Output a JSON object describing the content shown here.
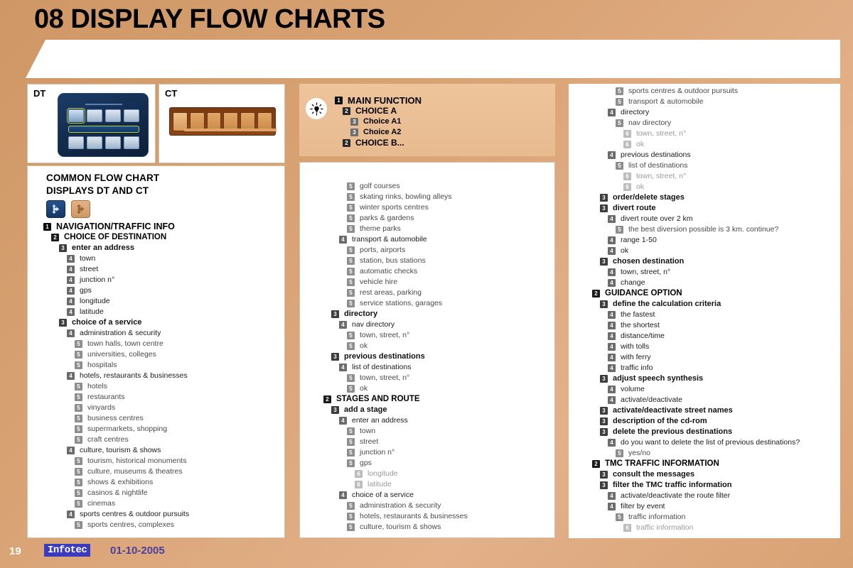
{
  "header": {
    "title": "08 DISPLAY FLOW CHARTS"
  },
  "panels": {
    "dt_label": "DT",
    "ct_label": "CT"
  },
  "left_panel": {
    "heading_line1": "COMMON FLOW CHART",
    "heading_line2": "DISPLAYS DT AND CT",
    "icons": [
      {
        "name": "navigation-arrow-icon-blue"
      },
      {
        "name": "navigation-arrow-icon-tan"
      }
    ],
    "tree": [
      {
        "level": 1,
        "label": "NAVIGATION/TRAFFIC INFO"
      },
      {
        "level": 2,
        "label": "CHOICE OF DESTINATION"
      },
      {
        "level": 3,
        "label": "enter an address"
      },
      {
        "level": 4,
        "label": "town"
      },
      {
        "level": 4,
        "label": "street"
      },
      {
        "level": 4,
        "label": "junction n°"
      },
      {
        "level": 4,
        "label": "gps"
      },
      {
        "level": 4,
        "label": "longitude"
      },
      {
        "level": 4,
        "label": "latitude"
      },
      {
        "level": 3,
        "label": "choice of a service"
      },
      {
        "level": 4,
        "label": "administration & security"
      },
      {
        "level": 5,
        "label": "town halls, town centre"
      },
      {
        "level": 5,
        "label": "universities, colleges"
      },
      {
        "level": 5,
        "label": "hospitals"
      },
      {
        "level": 4,
        "label": "hotels, restaurants & businesses"
      },
      {
        "level": 5,
        "label": "hotels"
      },
      {
        "level": 5,
        "label": "restaurants"
      },
      {
        "level": 5,
        "label": "vinyards"
      },
      {
        "level": 5,
        "label": "business centres"
      },
      {
        "level": 5,
        "label": "supermarkets, shopping"
      },
      {
        "level": 5,
        "label": "craft centres"
      },
      {
        "level": 4,
        "label": "culture, tourism & shows"
      },
      {
        "level": 5,
        "label": "tourism, historical monuments"
      },
      {
        "level": 5,
        "label": "culture, museums & theatres"
      },
      {
        "level": 5,
        "label": "shows & exhibitions"
      },
      {
        "level": 5,
        "label": "casinos & nightlife"
      },
      {
        "level": 5,
        "label": "cinemas"
      },
      {
        "level": 4,
        "label": "sports centres & outdoor pursuits"
      },
      {
        "level": 5,
        "label": "sports centres, complexes"
      }
    ]
  },
  "legend": {
    "icon": "lightbulb-icon",
    "tree": [
      {
        "level": 1,
        "label": "MAIN FUNCTION"
      },
      {
        "level": 2,
        "label": "CHOICE A"
      },
      {
        "level": 3,
        "label": "Choice A1"
      },
      {
        "level": 3,
        "label": "Choice A2"
      },
      {
        "level": 2,
        "label": "CHOICE  B..."
      }
    ]
  },
  "mid_panel": {
    "tree": [
      {
        "level": 5,
        "label": "golf courses"
      },
      {
        "level": 5,
        "label": "skating rinks, bowling alleys"
      },
      {
        "level": 5,
        "label": "winter sports centres"
      },
      {
        "level": 5,
        "label": "parks & gardens"
      },
      {
        "level": 5,
        "label": "theme parks"
      },
      {
        "level": 4,
        "label": "transport & automobile"
      },
      {
        "level": 5,
        "label": "ports, airports"
      },
      {
        "level": 5,
        "label": "station, bus stations"
      },
      {
        "level": 5,
        "label": "automatic checks"
      },
      {
        "level": 5,
        "label": "vehicle hire"
      },
      {
        "level": 5,
        "label": "rest areas, parking"
      },
      {
        "level": 5,
        "label": "service stations, garages"
      },
      {
        "level": 3,
        "label": "directory"
      },
      {
        "level": 4,
        "label": "nav directory"
      },
      {
        "level": 5,
        "label": "town, street, n°"
      },
      {
        "level": 5,
        "label": "ok"
      },
      {
        "level": 3,
        "label": "previous destinations"
      },
      {
        "level": 4,
        "label": "list of destinations"
      },
      {
        "level": 5,
        "label": "town, street, n°"
      },
      {
        "level": 5,
        "label": "ok"
      },
      {
        "level": 2,
        "label": "STAGES AND ROUTE"
      },
      {
        "level": 3,
        "label": "add a stage"
      },
      {
        "level": 4,
        "label": "enter an address"
      },
      {
        "level": 5,
        "label": "town"
      },
      {
        "level": 5,
        "label": "street"
      },
      {
        "level": 5,
        "label": "junction n°"
      },
      {
        "level": 5,
        "label": "gps"
      },
      {
        "level": 6,
        "label": "longitude"
      },
      {
        "level": 6,
        "label": "latitude"
      },
      {
        "level": 4,
        "label": "choice of a service"
      },
      {
        "level": 5,
        "label": "administration & security"
      },
      {
        "level": 5,
        "label": "hotels, restaurants & businesses"
      },
      {
        "level": 5,
        "label": "culture, tourism & shows"
      }
    ]
  },
  "right_panel": {
    "tree": [
      {
        "level": 5,
        "label": "sports centres & outdoor pursuits"
      },
      {
        "level": 5,
        "label": "transport & automobile"
      },
      {
        "level": 4,
        "label": "directory"
      },
      {
        "level": 5,
        "label": "nav directory"
      },
      {
        "level": 6,
        "label": "town, street, n°"
      },
      {
        "level": 6,
        "label": "ok"
      },
      {
        "level": 4,
        "label": "previous destinations"
      },
      {
        "level": 5,
        "label": "list of destinations"
      },
      {
        "level": 6,
        "label": "town, street, n°"
      },
      {
        "level": 6,
        "label": "ok"
      },
      {
        "level": 3,
        "label": "order/delete stages"
      },
      {
        "level": 3,
        "label": "divert route"
      },
      {
        "level": 4,
        "label": "divert route over 2 km"
      },
      {
        "level": 5,
        "label": "the best diversion possible is 3 km. continue?"
      },
      {
        "level": 4,
        "label": "range 1-50"
      },
      {
        "level": 4,
        "label": "ok"
      },
      {
        "level": 3,
        "label": "chosen destination"
      },
      {
        "level": 4,
        "label": "town, street, n°"
      },
      {
        "level": 4,
        "label": "change"
      },
      {
        "level": 2,
        "label": "GUIDANCE OPTION"
      },
      {
        "level": 3,
        "label": "define the calculation criteria"
      },
      {
        "level": 4,
        "label": "the fastest"
      },
      {
        "level": 4,
        "label": "the shortest"
      },
      {
        "level": 4,
        "label": "distance/time"
      },
      {
        "level": 4,
        "label": "with tolls"
      },
      {
        "level": 4,
        "label": "with ferry"
      },
      {
        "level": 4,
        "label": "traffic info"
      },
      {
        "level": 3,
        "label": "adjust speech synthesis"
      },
      {
        "level": 4,
        "label": "volume"
      },
      {
        "level": 4,
        "label": "activate/deactivate"
      },
      {
        "level": 3,
        "label": "activate/deactivate street names"
      },
      {
        "level": 3,
        "label": "description of the cd-rom"
      },
      {
        "level": 3,
        "label": "delete the previous destinations"
      },
      {
        "level": 4,
        "label": "do you want to delete the list of previous destinations?"
      },
      {
        "level": 5,
        "label": "yes/no"
      },
      {
        "level": 2,
        "label": "TMC TRAFFIC INFORMATION"
      },
      {
        "level": 3,
        "label": "consult the messages"
      },
      {
        "level": 3,
        "label": "filter the TMC traffic information"
      },
      {
        "level": 4,
        "label": "activate/deactivate the route filter"
      },
      {
        "level": 4,
        "label": "filter by event"
      },
      {
        "level": 5,
        "label": "traffic information"
      },
      {
        "level": 6,
        "label": "traffic information"
      }
    ]
  },
  "footer": {
    "page_number": "19",
    "logo_text": "Infotec",
    "date": "01-10-2005"
  },
  "colors": {
    "page_background": "#d8a273",
    "title_background": "#ffffff",
    "panel_background": "#ffffff",
    "legend_background": "#eec49b",
    "logo_background": "#3b3bbf",
    "date_color": "#4a3f9e"
  }
}
